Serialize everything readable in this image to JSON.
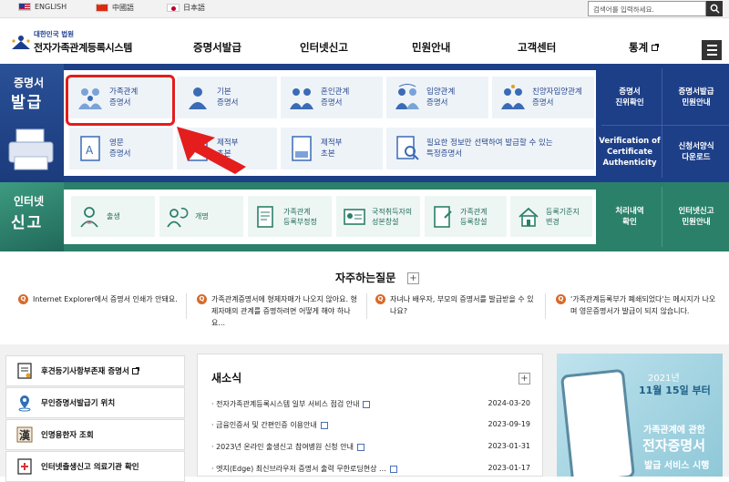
{
  "topbar": {
    "languages": [
      "ENGLISH",
      "中國語",
      "日本語"
    ],
    "search_placeholder": "검색어를 입력하세요."
  },
  "header": {
    "logo_small": "대한민국 법원",
    "logo_title": "전자가족관계등록시스템",
    "nav": [
      "증명서발급",
      "인터넷신고",
      "민원안내",
      "고객센터",
      "통계"
    ]
  },
  "certificate": {
    "side_small": "증명서",
    "side_big": "발급",
    "tiles": [
      "가족관계\n증명서",
      "기본\n증명서",
      "혼인관계\n증명서",
      "입양관계\n증명서",
      "친양자입양관계\n증명서",
      "영문\n증명서",
      "제적부\n초본",
      "제적부\n초본",
      "필요한 정보만 선택하여 발급할 수 있는\n특정증명서"
    ],
    "right_links": [
      "증명서\n진위확인",
      "증명서발급\n민원안내",
      "Verification of\nCertificate\nAuthenticity",
      "신청서양식\n다운로드"
    ]
  },
  "report": {
    "side_small": "인터넷",
    "side_big": "신고",
    "tiles": [
      "출생",
      "개명",
      "가족관계\n등록부정정",
      "국적취득자의\n성본창설",
      "가족관계\n등록창설",
      "등록기준지\n변경"
    ],
    "right_links": [
      "처리내역\n확인",
      "인터넷신고\n민원안내"
    ]
  },
  "faq": {
    "title": "자주하는질문",
    "items": [
      "Internet Explorer에서 증명서 인쇄가 안돼요.",
      "가족관계증명서에 형제자매가 나오지 않아요. 형제자매의 관계를 증명하려면 어떻게 해야 하나요...",
      "자녀나 배우자, 부모의 증명서를 발급받을 수 있나요?",
      "'가족관계등록부가 폐쇄되었다'는 메시지가 나오며 영문증명서가 발급이 되지 않습니다."
    ]
  },
  "quick_links": [
    "후견등기사항부존재 증명서",
    "무인증명서발급기 위치",
    "인명용한자 조회",
    "인터넷출생신고 의료기관 확인"
  ],
  "news": {
    "title": "새소식",
    "items": [
      {
        "text": "전자가족관계등록시스템 일부 서비스 점검 안내",
        "date": "2024-03-20"
      },
      {
        "text": "금융인증서 및 간편인증 이용안내",
        "date": "2023-09-19"
      },
      {
        "text": "2023년 온라인 출생신고 참여병원 신청 안내",
        "date": "2023-01-31"
      },
      {
        "text": "엣지(Edge) 최신브라우저 증명서 출력 무한로딩현상 ...",
        "date": "2023-01-17"
      }
    ]
  },
  "banner": {
    "year": "2021년",
    "date": "11월 15일 부터",
    "line1": "가족관계에 관한",
    "line2": "전자증명서",
    "line3": "발급 서비스 시행"
  },
  "colors": {
    "navy": "#1d3f87",
    "green": "#2b8069",
    "highlight": "#e41d1d"
  }
}
